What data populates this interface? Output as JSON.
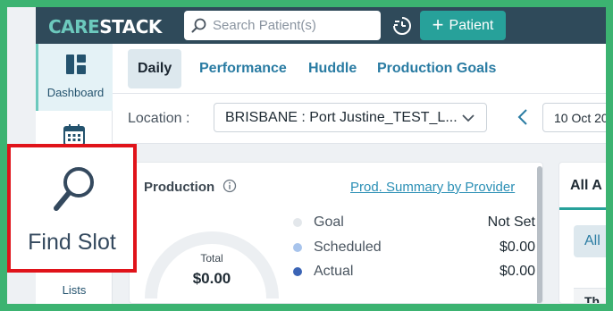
{
  "header": {
    "logo_left": "CARE",
    "logo_right": "STACK",
    "search_placeholder": "Search Patient(s)",
    "patient_button": "Patient"
  },
  "sidebar": {
    "dashboard_label": "Dashboard",
    "find_slot_label": "Find Slot",
    "lists_label": "Lists"
  },
  "tabs": [
    {
      "label": "Daily",
      "active": true
    },
    {
      "label": "Performance",
      "active": false
    },
    {
      "label": "Huddle",
      "active": false
    },
    {
      "label": "Production Goals",
      "active": false
    }
  ],
  "filters": {
    "location_label": "Location :",
    "location_value": "BRISBANE : Port Justine_TEST_L...",
    "date_value": "10 Oct 20"
  },
  "production": {
    "title": "Production",
    "link": "Prod. Summary by Provider",
    "total_label": "Total",
    "total_value": "$0.00",
    "legend": [
      {
        "label": "Goal",
        "value": "Not Set",
        "color": "#e3e7eb"
      },
      {
        "label": "Scheduled",
        "value": "$0.00",
        "color": "#a8c4ec"
      },
      {
        "label": "Actual",
        "value": "$0.00",
        "color": "#3b64b5"
      }
    ]
  },
  "right_panel": {
    "tab": "All A",
    "pill": "All",
    "row": "Th"
  },
  "colors": {
    "border_green": "#3cb371",
    "header_bg": "#2f4a5a",
    "accent_teal": "#27a19a",
    "highlight_red": "#e0131a"
  }
}
